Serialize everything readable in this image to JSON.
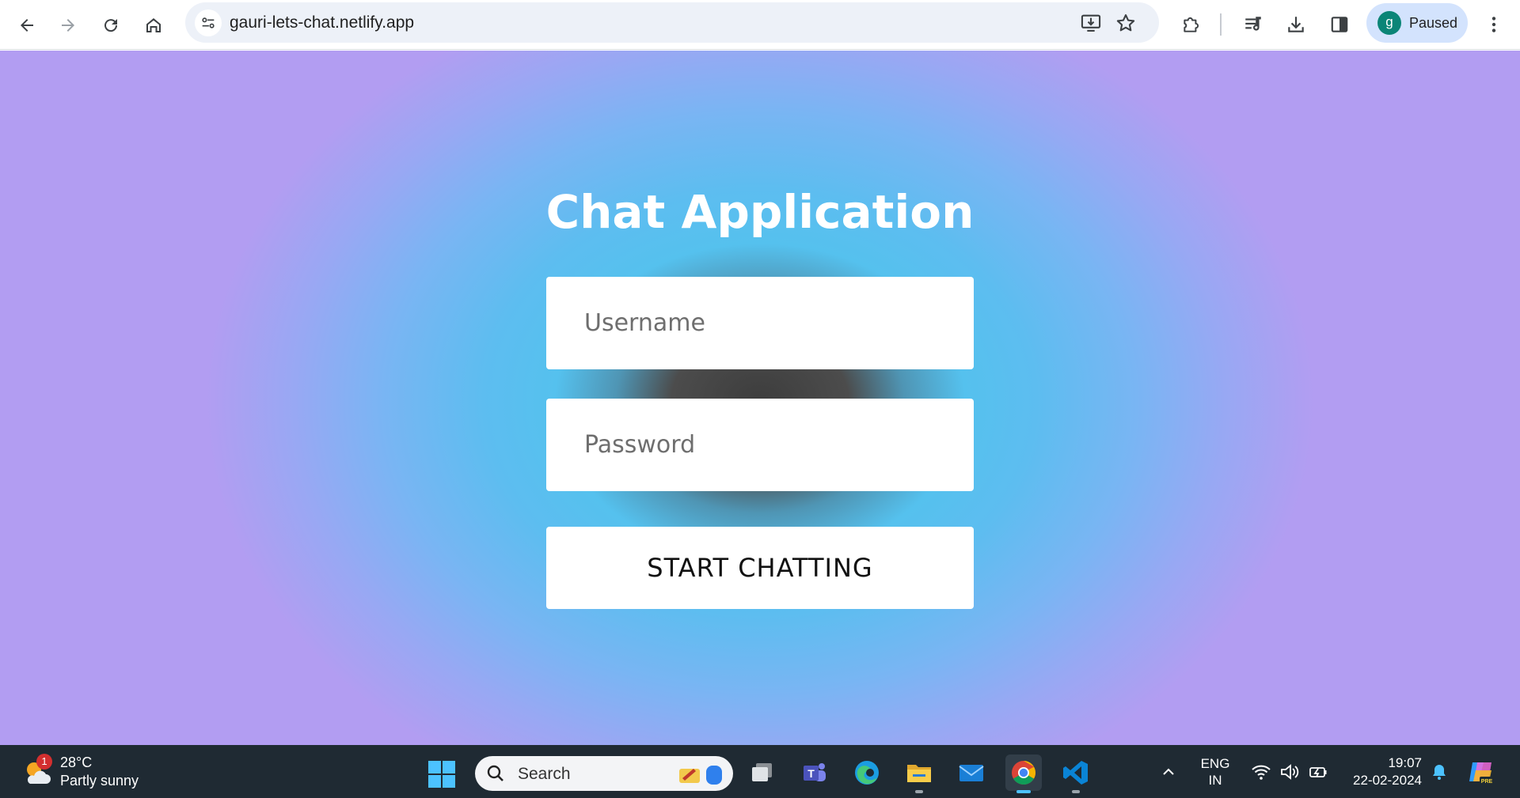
{
  "browser": {
    "url": "gauri-lets-chat.netlify.app",
    "profile": {
      "initial": "g",
      "status": "Paused"
    },
    "icons": [
      "back-icon",
      "forward-icon",
      "reload-icon",
      "home-icon",
      "site-info-icon",
      "install-app-icon",
      "bookmark-star-icon",
      "extensions-icon",
      "media-control-icon",
      "downloads-icon",
      "side-panel-icon",
      "menu-icon"
    ]
  },
  "page": {
    "title": "Chat Application",
    "username": {
      "placeholder": "Username",
      "value": ""
    },
    "password": {
      "placeholder": "Password",
      "value": ""
    },
    "submit_label": "START CHATTING"
  },
  "taskbar": {
    "weather": {
      "temperature": "28°C",
      "condition": "Partly sunny",
      "badge": "1"
    },
    "search_placeholder": "Search",
    "apps": [
      "windows-start",
      "task-view",
      "teams",
      "edge",
      "file-explorer",
      "mail",
      "chrome",
      "vscode"
    ],
    "language": {
      "line1": "ENG",
      "line2": "IN"
    },
    "time": "19:07",
    "date": "22-02-2024"
  },
  "colors": {
    "gradient_center": "#4c4c4c",
    "gradient_mid": "#55c1ee",
    "gradient_edge": "#b29df2",
    "taskbar": "#1f2a33",
    "accent": "#0b8577"
  }
}
